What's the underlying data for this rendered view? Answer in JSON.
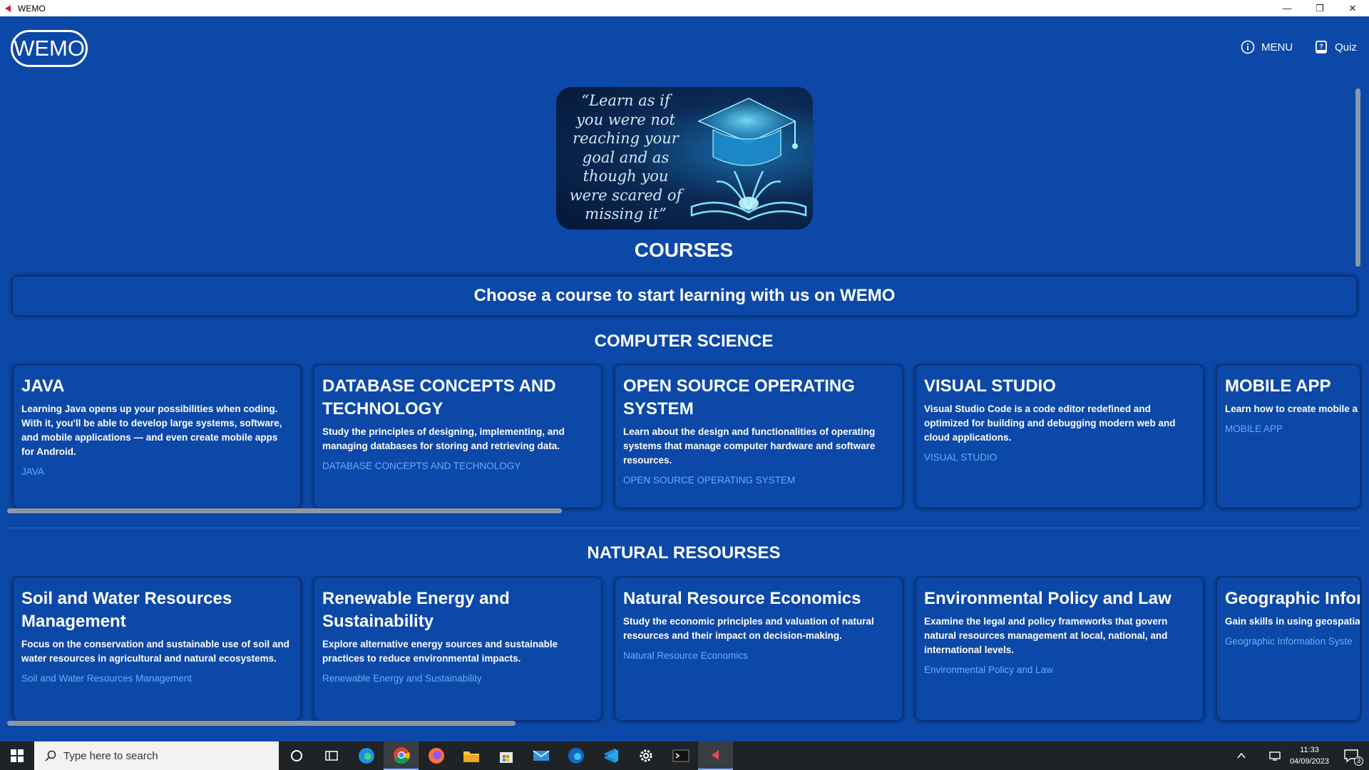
{
  "window": {
    "title": "WEMO",
    "minimize": "—",
    "restore": "❐",
    "close": "✕"
  },
  "header": {
    "logo": "WEMO",
    "menu_label": "MENU",
    "quiz_label": "Quiz"
  },
  "hero": {
    "quote_lines": [
      "“Learn as if",
      "you were not",
      "reaching your",
      "goal and as",
      "though you",
      "were scared of",
      "missing it”"
    ]
  },
  "courses_heading": "COURSES",
  "banner": "Choose a course to start learning with us on WEMO",
  "sections": [
    {
      "title": "COMPUTER SCIENCE",
      "cards": [
        {
          "title": "JAVA",
          "desc": "Learning Java opens up your possibilities when coding. With it, you'll be able to develop large systems, software, and mobile applications — and even create mobile apps for Android.",
          "link": "JAVA"
        },
        {
          "title": "DATABASE CONCEPTS AND TECHNOLOGY",
          "desc": "Study the principles of designing, implementing, and managing databases for storing and retrieving data.",
          "link": "DATABASE CONCEPTS AND TECHNOLOGY"
        },
        {
          "title": "OPEN SOURCE OPERATING SYSTEM",
          "desc": "Learn about the design and functionalities of operating systems that manage computer hardware and software resources.",
          "link": "OPEN SOURCE OPERATING SYSTEM"
        },
        {
          "title": "VISUAL STUDIO",
          "desc": "Visual Studio Code is a code editor redefined and optimized for building and debugging modern web and cloud applications.",
          "link": "VISUAL STUDIO"
        },
        {
          "title": "MOBILE APP",
          "desc": "Learn how to create mobile a iOS platforms.",
          "link": "MOBILE APP"
        }
      ]
    },
    {
      "title": "NATURAL RESOURSES",
      "cards": [
        {
          "title": "Soil and Water Resources Management",
          "desc": " Focus on the conservation and sustainable use of soil and water resources in agricultural and natural ecosystems.",
          "link": "Soil and Water Resources Management"
        },
        {
          "title": "Renewable Energy and Sustainability",
          "desc": " Explore alternative energy sources and sustainable practices to reduce environmental impacts.",
          "link": "Renewable Energy and Sustainability"
        },
        {
          "title": "Natural Resource Economics",
          "desc": "Study the economic principles and valuation of natural resources and their impact on decision-making.",
          "link": "Natural Resource Economics"
        },
        {
          "title": "Environmental Policy and Law",
          "desc": "Examine the legal and policy frameworks that govern natural resources management at local, national, and international levels.",
          "link": "Environmental Policy and Law"
        },
        {
          "title": "Geographic Infor (GIS) and Remote",
          "desc": "Gain skills in using geospatia and visualize natural resourc",
          "link": "Geographic Information Syste"
        }
      ]
    }
  ],
  "taskbar": {
    "search_placeholder": "Type here to search",
    "time": "11:33",
    "date": "04/09/2023",
    "notifications": "3"
  },
  "colors": {
    "background": "#0c48a8",
    "link": "#69aef5",
    "taskbar": "#202326"
  }
}
